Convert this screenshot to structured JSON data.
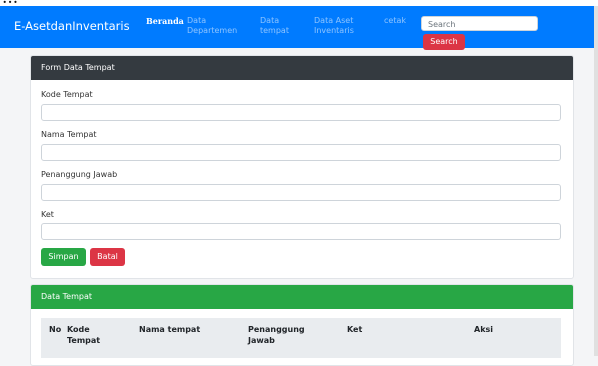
{
  "caption_fragment": "...",
  "navbar": {
    "brand": "E-AsetdanInventaris",
    "items": [
      {
        "label": "Beranda",
        "active": true
      },
      {
        "label": "Data Departemen",
        "active": false
      },
      {
        "label": "Data tempat",
        "active": false
      },
      {
        "label": "Data Aset Inventaris",
        "active": false
      },
      {
        "label": "cetak",
        "active": false
      }
    ],
    "search_placeholder": "Search",
    "search_button": "Search"
  },
  "form": {
    "title": "Form Data Tempat",
    "fields": [
      {
        "label": "Kode Tempat",
        "value": ""
      },
      {
        "label": "Nama Tempat",
        "value": ""
      },
      {
        "label": "Penanggung Jawab",
        "value": ""
      },
      {
        "label": "Ket",
        "value": ""
      }
    ],
    "save_label": "Simpan",
    "cancel_label": "Batal"
  },
  "table": {
    "title": "Data Tempat",
    "columns": [
      "No",
      "Kode Tempat",
      "Nama tempat",
      "Penanggung Jawab",
      "Ket",
      "Aksi"
    ]
  },
  "colors": {
    "navbar": "#007bff",
    "form_header": "#343a40",
    "table_header": "#28a745",
    "save": "#28a745",
    "cancel": "#dc3545"
  }
}
